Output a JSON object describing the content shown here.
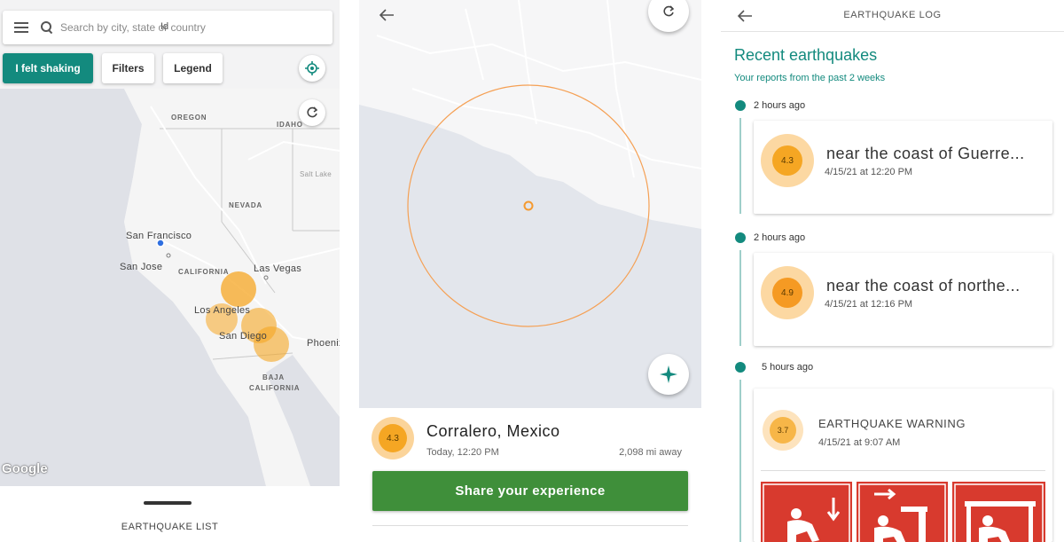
{
  "map_screen": {
    "search": {
      "placeholder": "Search by city, state or country"
    },
    "buttons": {
      "felt_shaking": "I felt shaking",
      "filters": "Filters",
      "legend": "Legend"
    },
    "labels": {
      "oregon": "OREGON",
      "idaho": "IDAHO",
      "salt_lake": "Salt Lake",
      "nevada": "NEVADA",
      "san_francisco": "San Francisco",
      "san_jose": "San Jose",
      "california": "CALIFORNIA",
      "las_vegas": "Las Vegas",
      "los_angeles": "Los Angeles",
      "san_diego": "San Diego",
      "phoenix": "Phoenix",
      "baja": "BAJA",
      "baja_california": "CALIFORNIA",
      "partial_id": "Id"
    },
    "google": "Google",
    "bottom_sheet_title": "EARTHQUAKE LIST"
  },
  "detail_screen": {
    "magnitude": "4.3",
    "place": "Corralero, Mexico",
    "time": "Today, 12:20 PM",
    "distance": "2,098 mi away",
    "share_button": "Share your experience"
  },
  "log_screen": {
    "title": "EARTHQUAKE LOG",
    "heading": "Recent earthquakes",
    "subheading": "Your reports from the past 2 weeks",
    "entries": [
      {
        "time_ago": "2 hours ago",
        "magnitude": "4.3",
        "title": "near the coast of Guerre...",
        "date": "4/15/21 at 12:20 PM"
      },
      {
        "time_ago": "2 hours ago",
        "magnitude": "4.9",
        "title": "near the coast of northe...",
        "date": "4/15/21 at 12:16 PM"
      },
      {
        "time_ago": "5 hours ago",
        "magnitude": "3.7",
        "title": "EARTHQUAKE WARNING",
        "date": "4/15/21 at 9:07 AM"
      }
    ]
  },
  "colors": {
    "accent_teal": "#138a7e",
    "share_green": "#3f8f3a",
    "quake_orange": "#f5a623",
    "warning_red": "#d83a2e"
  }
}
